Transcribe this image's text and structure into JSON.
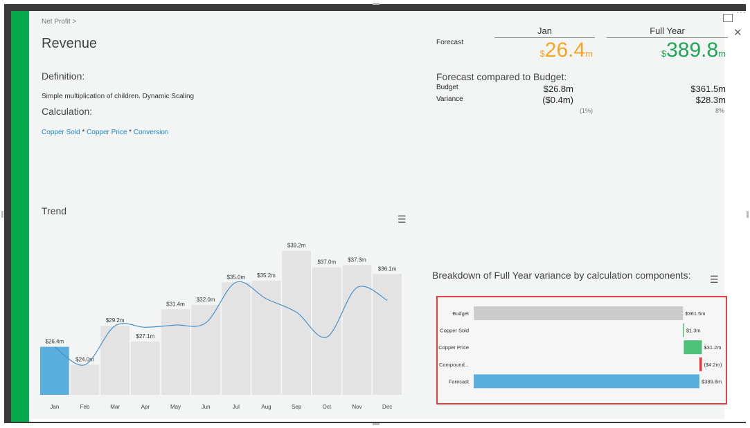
{
  "breadcrumb": "Net Profit  >",
  "title": "Revenue",
  "definition_label": "Definition:",
  "definition_text": "Simple multiplication of children. Dynamic Scaling",
  "calculation_label": "Calculation:",
  "calculation": {
    "term1": "Copper Sold",
    "op1": " * ",
    "term2": "Copper Price",
    "op2": " * ",
    "term3": "Conversion"
  },
  "trend_title": "Trend",
  "forecast_label": "Forecast",
  "period_headers": {
    "jan": "Jan",
    "full_year": "Full Year"
  },
  "forecast": {
    "jan": {
      "currency": "$",
      "value": "26.4",
      "unit": "m"
    },
    "full_year": {
      "currency": "$",
      "value": "389.8",
      "unit": "m"
    }
  },
  "compared_title": "Forecast compared to Budget:",
  "budget_label": "Budget",
  "variance_label": "Variance",
  "budget": {
    "jan": "$26.8m",
    "full_year": "$361.5m"
  },
  "variance": {
    "jan": "($0.4m)",
    "full_year": "$28.3m"
  },
  "variance_pct": {
    "jan": "(1%)",
    "full_year": "8%"
  },
  "breakdown_title": "Breakdown of Full Year variance by calculation components:",
  "colors": {
    "accent_green": "#05a84a",
    "bar_highlight": "#5aaedc",
    "bar_default": "#e3e3e3",
    "line": "#4a90c8",
    "positive": "#4cc17a",
    "negative": "#e8383d",
    "orange": "#f5a623"
  },
  "chart_data": [
    {
      "type": "bar",
      "categories": [
        "Jan",
        "Feb",
        "Mar",
        "Apr",
        "May",
        "Jun",
        "Jul",
        "Aug",
        "Sep",
        "Oct",
        "Nov",
        "Dec"
      ],
      "values": [
        26.4,
        24.0,
        29.2,
        27.1,
        31.4,
        32.0,
        35.0,
        35.2,
        39.2,
        37.0,
        37.3,
        36.1
      ],
      "labels": [
        "$26.4m",
        "$24.0m",
        "$29.2m",
        "$27.1m",
        "$31.4m",
        "$32.0m",
        "$35.0m",
        "$35.2m",
        "$39.2m",
        "$37.0m",
        "$37.3m",
        "$36.1m"
      ],
      "highlight_index": 0,
      "line_values": [
        26.4,
        24.0,
        29.2,
        29.0,
        29.3,
        29.6,
        35.0,
        32.8,
        31.0,
        27.7,
        34.3,
        32.6
      ],
      "ylim": [
        20,
        40
      ],
      "grid": false,
      "legend": "none"
    },
    {
      "type": "bar",
      "orientation": "horizontal",
      "categories": [
        "Budget",
        "Copper Sold",
        "Copper Price",
        "Compound...",
        "Forecast"
      ],
      "values": [
        361.5,
        1.3,
        31.2,
        -4.2,
        389.8
      ],
      "labels": [
        "$361.5m",
        "$1.3m",
        "$31.2m",
        "($4.2m)",
        "$389.8m"
      ],
      "waterfall": true
    }
  ]
}
